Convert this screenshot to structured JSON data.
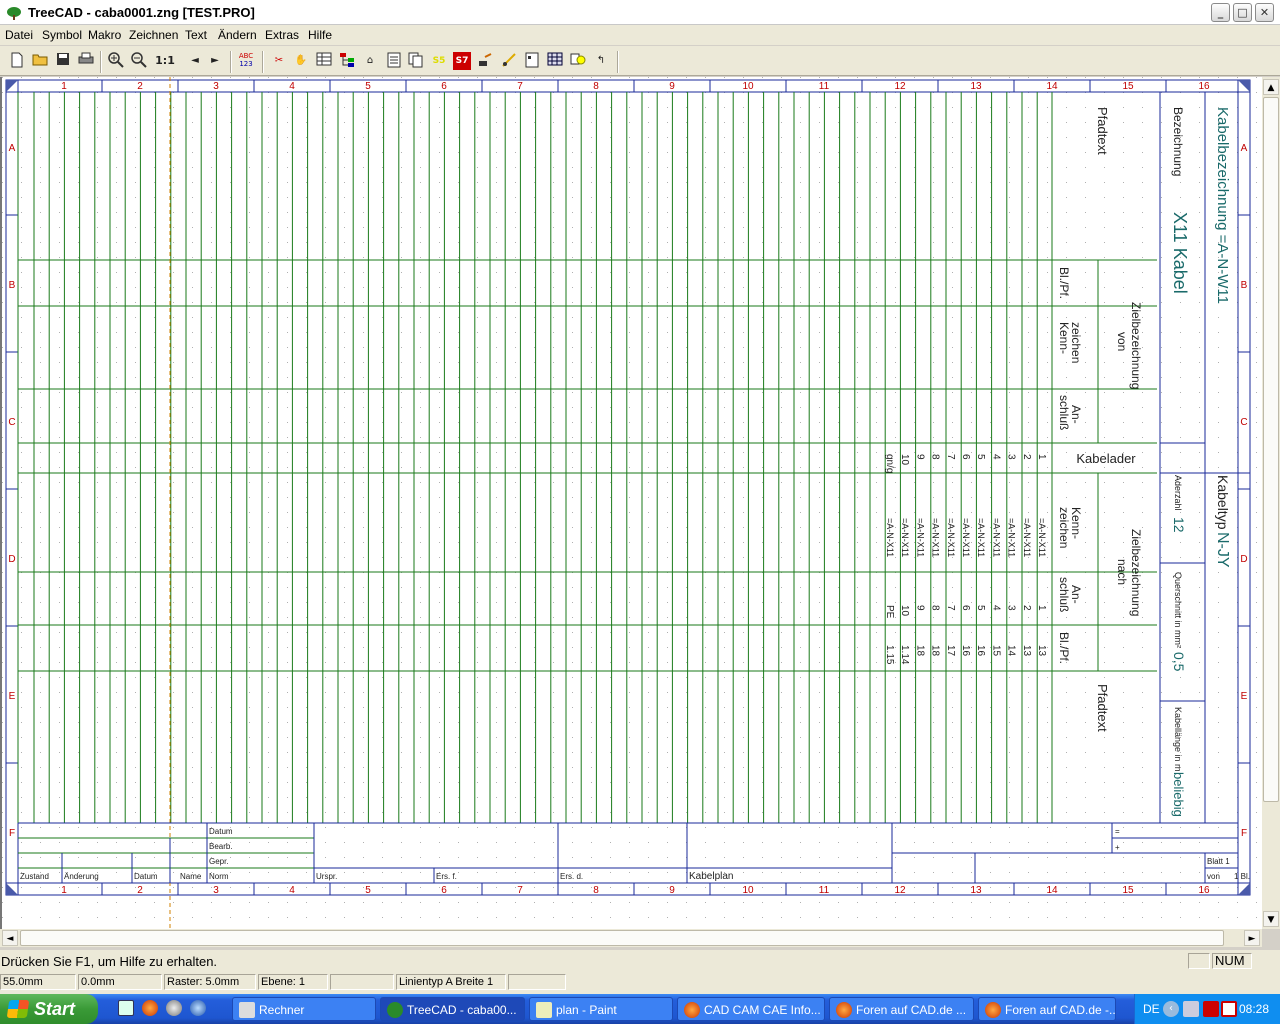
{
  "window": {
    "title": "TreeCAD - caba0001.zng [TEST.PRO]",
    "min": "_",
    "max": "□",
    "close": "✕"
  },
  "menu": [
    "Datei",
    "Symbol",
    "Makro",
    "Zeichnen",
    "Text",
    "Ändern",
    "Extras",
    "Hilfe"
  ],
  "toolbar": {
    "zoom_label": "1:1",
    "abc_label": "ABC",
    "abc_num": "123",
    "s7_label": "S7",
    "s5_label": "S5"
  },
  "drawing": {
    "column_numbers": [
      "1",
      "2",
      "3",
      "4",
      "5",
      "6",
      "7",
      "8",
      "9",
      "10",
      "11",
      "12",
      "13",
      "14",
      "15",
      "16"
    ],
    "row_letters": [
      "A",
      "B",
      "C",
      "D",
      "E",
      "F"
    ],
    "header": {
      "pfadtext": "Pfadtext",
      "bezeichnung": "Bezeichnung",
      "bezeichnung_value": "X11 Kabel",
      "kabelbezeichnung": "Kabelbezeichnung =A-N-W11",
      "bl_pf": "Bl./Pf.",
      "kennzeichen": "Kenn- zeichen",
      "zielbezeichnung_von": "Zielbezeichnung von",
      "anschluss": "An- schluß",
      "kabelader": "Kabelader",
      "zielbezeichnung_nach": "Zielbezeichnung nach",
      "aderzahl_label": "Aderzahl",
      "aderzahl_value": "12",
      "kabeltyp_label": "Kabeltyp",
      "kabeltyp_value": "N-JY",
      "querschnitt_label": "Querschnitt in mm²",
      "querschnitt_value": "0,5",
      "kabellaenge_label": "Kabellänge in m",
      "kabellaenge_value": "beliebig",
      "pfadtext2": "Pfadtext"
    },
    "cores": [
      "1",
      "2",
      "3",
      "4",
      "5",
      "6",
      "7",
      "8",
      "9",
      "10",
      "gn/g"
    ],
    "core_targets": [
      "=A-N-X11",
      "=A-N-X11",
      "=A-N-X11",
      "=A-N-X11",
      "=A-N-X11",
      "=A-N-X11",
      "=A-N-X11",
      "=A-N-X11",
      "=A-N-X11",
      "=A-N-X11",
      "=A-N-X11"
    ],
    "core_terminals": [
      "1",
      "2",
      "3",
      "4",
      "5",
      "6",
      "7",
      "8",
      "9",
      "10",
      "PE"
    ],
    "core_pages": [
      "13",
      "13",
      "14",
      "15",
      "16",
      "16",
      "17",
      "18",
      "18",
      "1.14",
      "1.15"
    ],
    "title_block": {
      "datum": "Datum",
      "bearb": "Bearb.",
      "gepr": "Gepr.",
      "norm": "Norm",
      "zustand": "Zustand",
      "aenderung": "Änderung",
      "datum2": "Datum",
      "name": "Name",
      "urspr": "Urspr.",
      "ers_f": "Ers. f.",
      "ers_d": "Ers. d.",
      "kabelplan": "Kabelplan",
      "eq": "=",
      "plus": "+",
      "blatt": "Blatt 1",
      "von": "von",
      "von_value": "1 Bl."
    }
  },
  "status": {
    "help": "Drücken Sie F1, um Hilfe zu erhalten.",
    "x": "55.0mm",
    "y": "0.0mm",
    "raster": "Raster: 5.0mm",
    "ebene": "Ebene: 1",
    "linetype": "Linientyp A Breite 1",
    "num": "NUM"
  },
  "taskbar": {
    "start": "Start",
    "tasks": [
      "Rechner",
      "TreeCAD - caba00...",
      "plan - Paint",
      "CAD CAM CAE Info...",
      "Foren auf CAD.de ...",
      "Foren auf CAD.de -..."
    ],
    "lang": "DE",
    "clock": "08:28"
  },
  "colors": {
    "grid": "#1a7a1a",
    "frame": "#1a2a9a",
    "numbers": "#c00000",
    "text": "#222"
  }
}
